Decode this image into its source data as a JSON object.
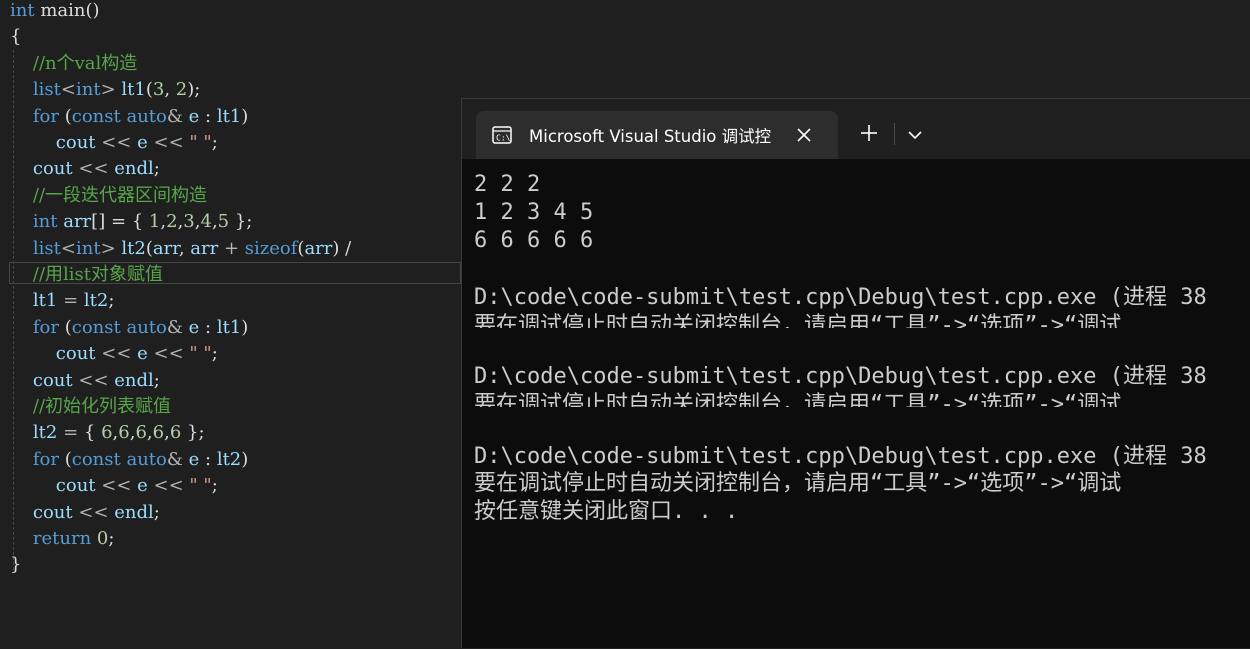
{
  "editor": {
    "lines": [
      [
        [
          "kw",
          "int"
        ],
        [
          "pl",
          " main()"
        ]
      ],
      [
        [
          "pl",
          "{"
        ]
      ],
      [
        [
          "pl",
          "    "
        ],
        [
          "cmt",
          "//n个val构造"
        ]
      ],
      [
        [
          "pl",
          "    "
        ],
        [
          "kw",
          "list"
        ],
        [
          "op",
          "<"
        ],
        [
          "kw",
          "int"
        ],
        [
          "op",
          "> "
        ],
        [
          "var",
          "lt1"
        ],
        [
          "pl",
          "("
        ],
        [
          "num",
          "3"
        ],
        [
          "pl",
          ", "
        ],
        [
          "num",
          "2"
        ],
        [
          "pl",
          ");"
        ]
      ],
      [
        [
          "pl",
          "    "
        ],
        [
          "kw",
          "for"
        ],
        [
          "pl",
          " ("
        ],
        [
          "kw",
          "const"
        ],
        [
          "pl",
          " "
        ],
        [
          "kw",
          "auto"
        ],
        [
          "op",
          "&"
        ],
        [
          "pl",
          " "
        ],
        [
          "var",
          "e"
        ],
        [
          "pl",
          " : "
        ],
        [
          "var",
          "lt1"
        ],
        [
          "pl",
          ")"
        ]
      ],
      [
        [
          "pl",
          "        "
        ],
        [
          "var",
          "cout"
        ],
        [
          "op",
          " << "
        ],
        [
          "var",
          "e"
        ],
        [
          "op",
          " << "
        ],
        [
          "str",
          "\" \""
        ],
        [
          "pl",
          ";"
        ]
      ],
      [
        [
          "pl",
          "    "
        ],
        [
          "var",
          "cout"
        ],
        [
          "op",
          " << "
        ],
        [
          "var",
          "endl"
        ],
        [
          "pl",
          ";"
        ]
      ],
      [
        [
          "pl",
          "    "
        ],
        [
          "cmt",
          "//一段迭代器区间构造"
        ]
      ],
      [
        [
          "pl",
          "    "
        ],
        [
          "kw",
          "int"
        ],
        [
          "pl",
          " "
        ],
        [
          "var",
          "arr"
        ],
        [
          "pl",
          "[] = { "
        ],
        [
          "num",
          "1"
        ],
        [
          "pl",
          ","
        ],
        [
          "num",
          "2"
        ],
        [
          "pl",
          ","
        ],
        [
          "num",
          "3"
        ],
        [
          "pl",
          ","
        ],
        [
          "num",
          "4"
        ],
        [
          "pl",
          ","
        ],
        [
          "num",
          "5"
        ],
        [
          "pl",
          " };"
        ]
      ],
      [
        [
          "pl",
          "    "
        ],
        [
          "kw",
          "list"
        ],
        [
          "op",
          "<"
        ],
        [
          "kw",
          "int"
        ],
        [
          "op",
          "> "
        ],
        [
          "var",
          "lt2"
        ],
        [
          "pl",
          "("
        ],
        [
          "var",
          "arr"
        ],
        [
          "pl",
          ", "
        ],
        [
          "var",
          "arr"
        ],
        [
          "op",
          " + "
        ],
        [
          "kw",
          "sizeof"
        ],
        [
          "pl",
          "("
        ],
        [
          "var",
          "arr"
        ],
        [
          "pl",
          ") /"
        ]
      ],
      [
        [
          "pl",
          "    "
        ],
        [
          "cmt",
          "//用list对象赋值"
        ]
      ],
      [
        [
          "pl",
          "    "
        ],
        [
          "var",
          "lt1"
        ],
        [
          "op",
          " = "
        ],
        [
          "var",
          "lt2"
        ],
        [
          "pl",
          ";"
        ]
      ],
      [
        [
          "pl",
          "    "
        ],
        [
          "kw",
          "for"
        ],
        [
          "pl",
          " ("
        ],
        [
          "kw",
          "const"
        ],
        [
          "pl",
          " "
        ],
        [
          "kw",
          "auto"
        ],
        [
          "op",
          "&"
        ],
        [
          "pl",
          " "
        ],
        [
          "var",
          "e"
        ],
        [
          "pl",
          " : "
        ],
        [
          "var",
          "lt1"
        ],
        [
          "pl",
          ")"
        ]
      ],
      [
        [
          "pl",
          "        "
        ],
        [
          "var",
          "cout"
        ],
        [
          "op",
          " << "
        ],
        [
          "var",
          "e"
        ],
        [
          "op",
          " << "
        ],
        [
          "str",
          "\" \""
        ],
        [
          "pl",
          ";"
        ]
      ],
      [
        [
          "pl",
          "    "
        ],
        [
          "var",
          "cout"
        ],
        [
          "op",
          " << "
        ],
        [
          "var",
          "endl"
        ],
        [
          "pl",
          ";"
        ]
      ],
      [
        [
          "pl",
          "    "
        ],
        [
          "cmt",
          "//初始化列表赋值"
        ]
      ],
      [
        [
          "pl",
          "    "
        ],
        [
          "var",
          "lt2"
        ],
        [
          "op",
          " = "
        ],
        [
          "pl",
          "{ "
        ],
        [
          "num",
          "6"
        ],
        [
          "pl",
          ","
        ],
        [
          "num",
          "6"
        ],
        [
          "pl",
          ","
        ],
        [
          "num",
          "6"
        ],
        [
          "pl",
          ","
        ],
        [
          "num",
          "6"
        ],
        [
          "pl",
          ","
        ],
        [
          "num",
          "6"
        ],
        [
          "pl",
          " };"
        ]
      ],
      [
        [
          "pl",
          "    "
        ],
        [
          "kw",
          "for"
        ],
        [
          "pl",
          " ("
        ],
        [
          "kw",
          "const"
        ],
        [
          "pl",
          " "
        ],
        [
          "kw",
          "auto"
        ],
        [
          "op",
          "&"
        ],
        [
          "pl",
          " "
        ],
        [
          "var",
          "e"
        ],
        [
          "pl",
          " : "
        ],
        [
          "var",
          "lt2"
        ],
        [
          "pl",
          ")"
        ]
      ],
      [
        [
          "pl",
          "        "
        ],
        [
          "var",
          "cout"
        ],
        [
          "op",
          " << "
        ],
        [
          "var",
          "e"
        ],
        [
          "op",
          " << "
        ],
        [
          "str",
          "\" \""
        ],
        [
          "pl",
          ";"
        ]
      ],
      [
        [
          "pl",
          "    "
        ],
        [
          "var",
          "cout"
        ],
        [
          "op",
          " << "
        ],
        [
          "var",
          "endl"
        ],
        [
          "pl",
          ";"
        ]
      ],
      [
        [
          "pl",
          "    "
        ],
        [
          "kw",
          "return"
        ],
        [
          "pl",
          " "
        ],
        [
          "num",
          "0"
        ],
        [
          "pl",
          ";"
        ]
      ],
      [
        [
          "pl",
          "}"
        ]
      ]
    ]
  },
  "terminal": {
    "tab_title": "Microsoft Visual Studio 调试控",
    "tab_icon": "terminal-icon",
    "close_icon": "close-icon",
    "new_tab_icon": "plus-icon",
    "dropdown_icon": "chevron-down-icon",
    "output": {
      "line1": "2 2 2",
      "line2": "1 2 3 4 5",
      "line3": "6 6 6 6 6",
      "exit1": "D:\\code\\code-submit\\test.cpp\\Debug\\test.cpp.exe (进程 38",
      "hint1": "要在调试停止时自动关闭控制台，请启用“工具”->“选项”->“调试",
      "exit2": "D:\\code\\code-submit\\test.cpp\\Debug\\test.cpp.exe (进程 38",
      "hint2": "要在调试停止时自动关闭控制台，请启用“工具”->“选项”->“调试",
      "exit3": "D:\\code\\code-submit\\test.cpp\\Debug\\test.cpp.exe (进程 38",
      "hint3": "要在调试停止时自动关闭控制台，请启用“工具”->“选项”->“调试",
      "press_key": "按任意键关闭此窗口. . ."
    }
  }
}
